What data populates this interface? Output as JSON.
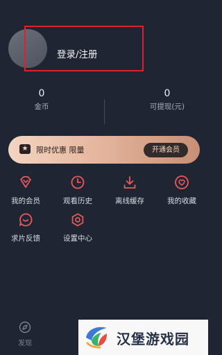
{
  "profile": {
    "login_label": "登录/注册"
  },
  "stats": [
    {
      "value": "0",
      "label": "金币"
    },
    {
      "value": "0",
      "label": "可提现(元)"
    }
  ],
  "vip_banner": {
    "text": "限时优惠 限量",
    "button": "开通会员"
  },
  "menu": [
    {
      "label": "我的会员",
      "icon": "diamond-icon"
    },
    {
      "label": "观看历史",
      "icon": "clock-icon"
    },
    {
      "label": "离线缓存",
      "icon": "download-icon"
    },
    {
      "label": "我的收藏",
      "icon": "heart-icon"
    },
    {
      "label": "求片反馈",
      "icon": "message-icon"
    },
    {
      "label": "设置中心",
      "icon": "gear-icon"
    }
  ],
  "bottom_nav": {
    "discover_label": "发现"
  },
  "watermark": {
    "text": "汉堡游戏园"
  },
  "colors": {
    "accent": "#e85a5a",
    "background": "#1f2533",
    "vip_gold": "#e6b79f"
  }
}
